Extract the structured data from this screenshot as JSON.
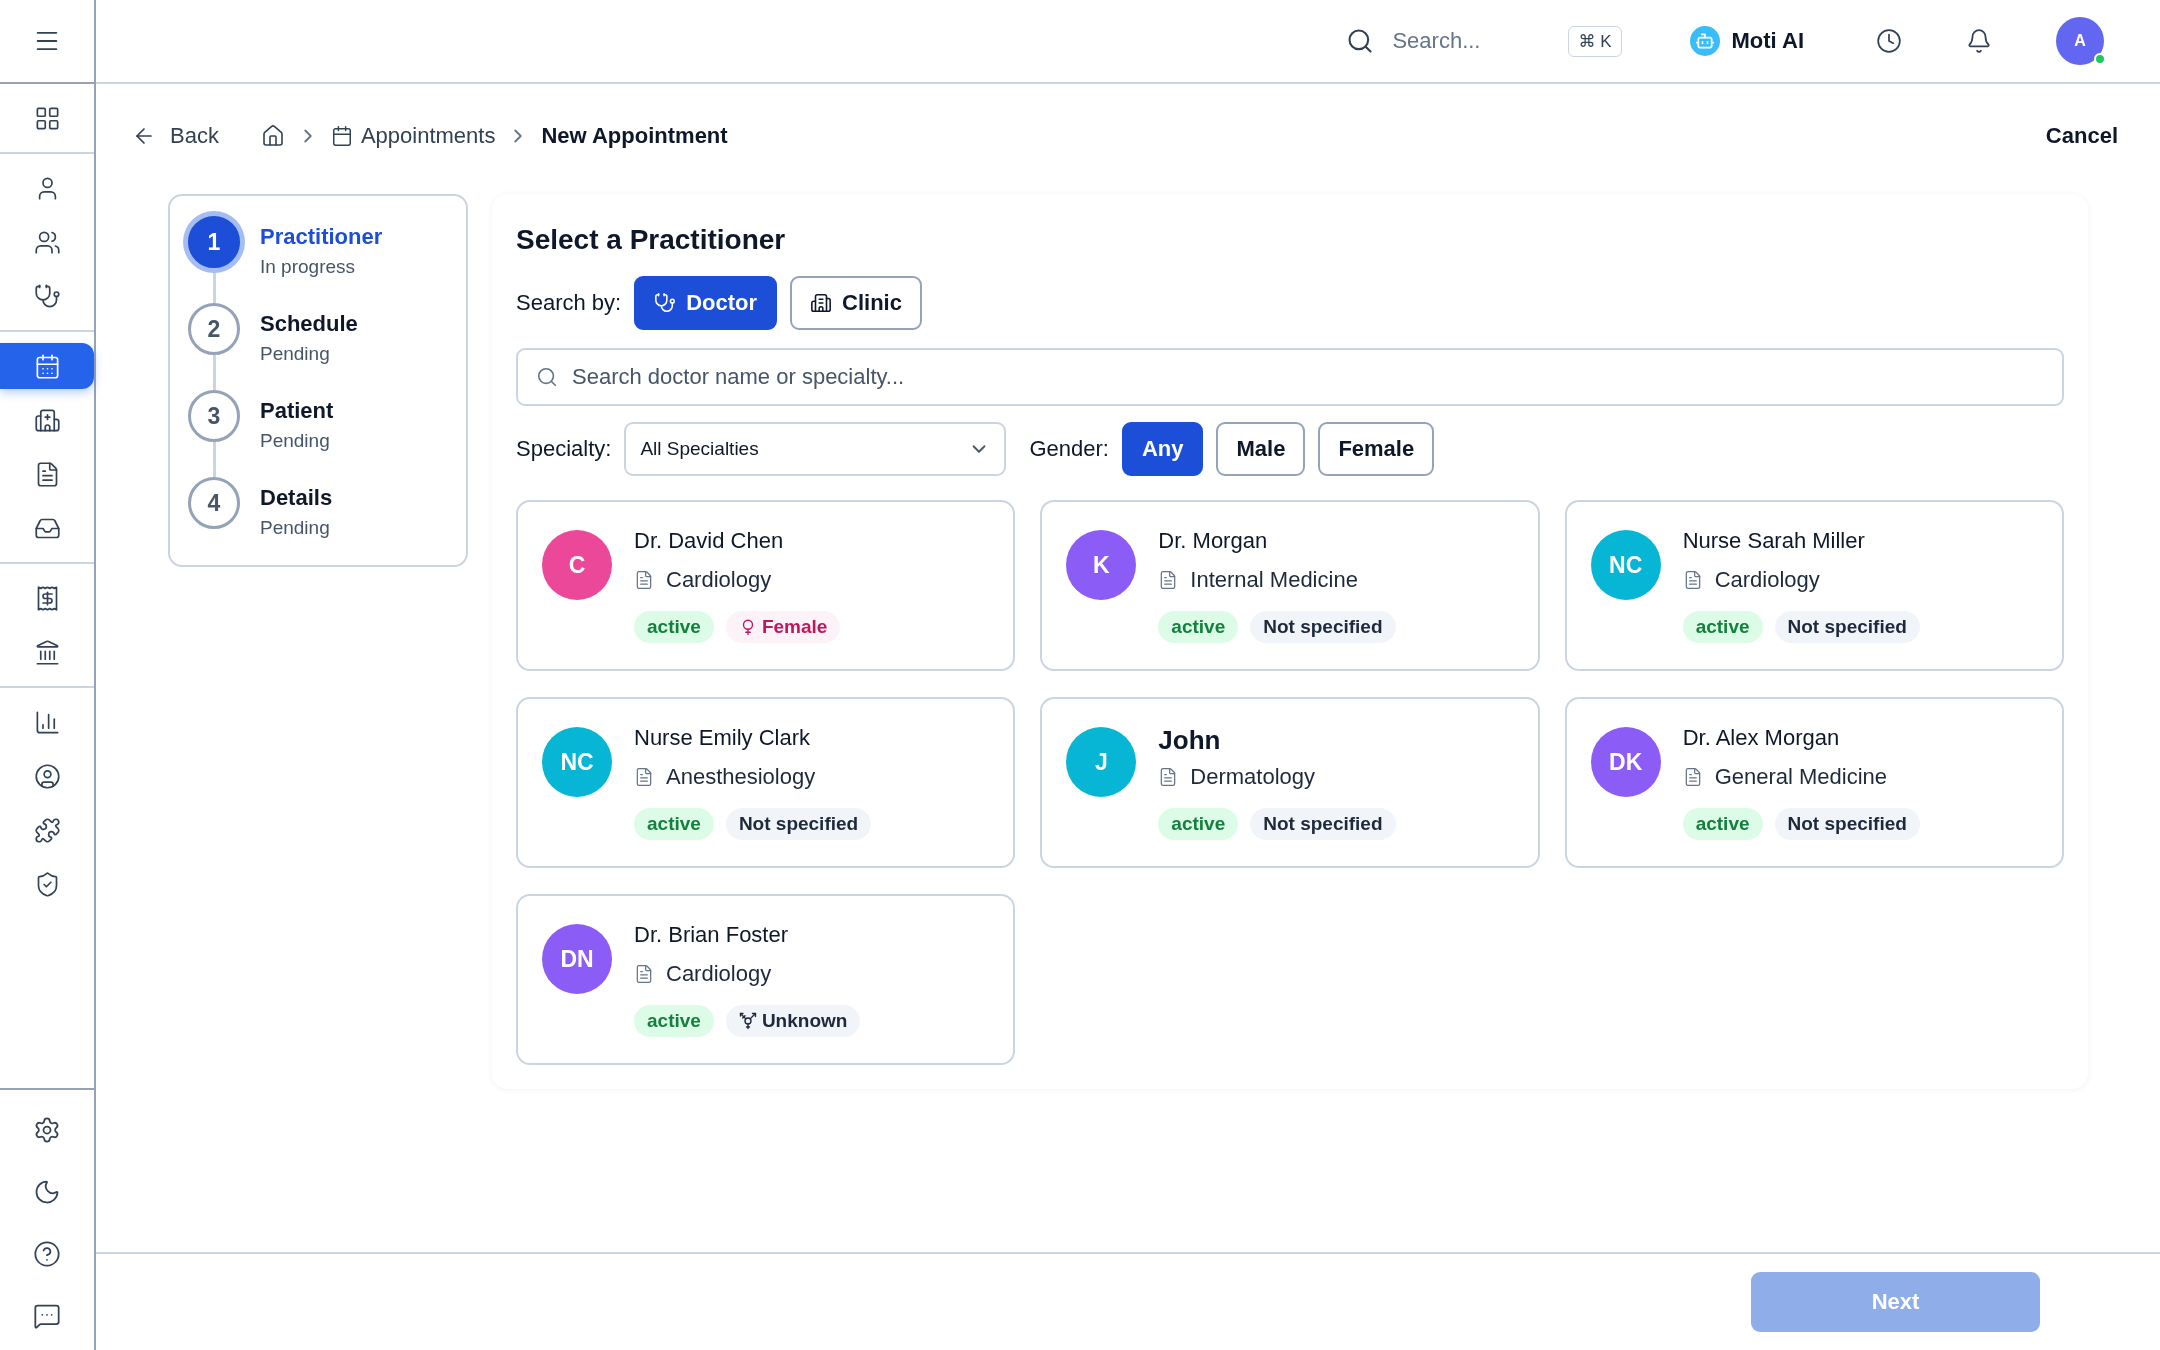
{
  "topbar": {
    "search": {
      "placeholder": "Search..."
    },
    "shortcut": "⌘ K",
    "assistant": "Moti AI",
    "avatar": {
      "initial": "A",
      "online": true
    }
  },
  "sidebar": {
    "groups": [
      [
        {
          "selected": false
        }
      ],
      [
        {
          "selected": false
        },
        {
          "selected": false
        },
        {
          "selected": false
        }
      ],
      [
        {
          "selected": true
        },
        {
          "selected": false
        },
        {
          "selected": false
        },
        {
          "selected": false
        }
      ],
      [
        {
          "selected": false
        },
        {
          "selected": false
        }
      ],
      [
        {
          "selected": false
        },
        {
          "selected": false
        },
        {
          "selected": false
        },
        {
          "selected": false
        }
      ]
    ]
  },
  "breadcrumb": {
    "back": "Back",
    "items": [
      "Appointments",
      "New Appointment"
    ],
    "cancel": "Cancel"
  },
  "steps": [
    {
      "number": "1",
      "title": "Practitioner",
      "status": "In progress",
      "selected": true
    },
    {
      "number": "2",
      "title": "Schedule",
      "status": "Pending",
      "selected": false
    },
    {
      "number": "3",
      "title": "Patient",
      "status": "Pending",
      "selected": false
    },
    {
      "number": "4",
      "title": "Details",
      "status": "Pending",
      "selected": false
    }
  ],
  "panel": {
    "title": "Select a Practitioner",
    "search_by_label": "Search by:",
    "search_by": [
      {
        "label": "Doctor",
        "selected": true
      },
      {
        "label": "Clinic",
        "selected": false
      }
    ],
    "search": {
      "placeholder": "Search doctor name or specialty..."
    },
    "specialty_label": "Specialty:",
    "specialty": "All Specialties",
    "gender_label": "Gender:",
    "gender": [
      {
        "label": "Any",
        "selected": true
      },
      {
        "label": "Male",
        "selected": false
      },
      {
        "label": "Female",
        "selected": false
      }
    ],
    "practitioners": [
      {
        "initials": "C",
        "color": "#ec4899",
        "name": "Dr. David Chen",
        "emphasized": false,
        "specialty": "Cardiology",
        "status": "active",
        "gender": {
          "kind": "female",
          "label": "Female"
        }
      },
      {
        "initials": "K",
        "color": "#8b5cf6",
        "name": "Dr. Morgan",
        "emphasized": false,
        "specialty": "Internal Medicine",
        "status": "active",
        "gender": {
          "kind": "none",
          "label": "Not specified"
        }
      },
      {
        "initials": "NC",
        "color": "#06b6d4",
        "name": "Nurse Sarah Miller",
        "emphasized": false,
        "specialty": "Cardiology",
        "status": "active",
        "gender": {
          "kind": "none",
          "label": "Not specified"
        }
      },
      {
        "initials": "NC",
        "color": "#06b6d4",
        "name": "Nurse Emily Clark",
        "emphasized": false,
        "specialty": "Anesthesiology",
        "status": "active",
        "gender": {
          "kind": "none",
          "label": "Not specified"
        }
      },
      {
        "initials": "J",
        "color": "#06b6d4",
        "name": "John",
        "emphasized": true,
        "specialty": "Dermatology",
        "status": "active",
        "gender": {
          "kind": "none",
          "label": "Not specified"
        }
      },
      {
        "initials": "DK",
        "color": "#8b5cf6",
        "name": "Dr. Alex Morgan",
        "emphasized": false,
        "specialty": "General Medicine",
        "status": "active",
        "gender": {
          "kind": "none",
          "label": "Not specified"
        }
      },
      {
        "initials": "DN",
        "color": "#8b5cf6",
        "name": "Dr. Brian Foster",
        "emphasized": false,
        "specialty": "Cardiology",
        "status": "active",
        "gender": {
          "kind": "unknown",
          "label": "Unknown"
        }
      }
    ]
  },
  "footer": {
    "next": {
      "label": "Next",
      "disabled": true
    }
  }
}
